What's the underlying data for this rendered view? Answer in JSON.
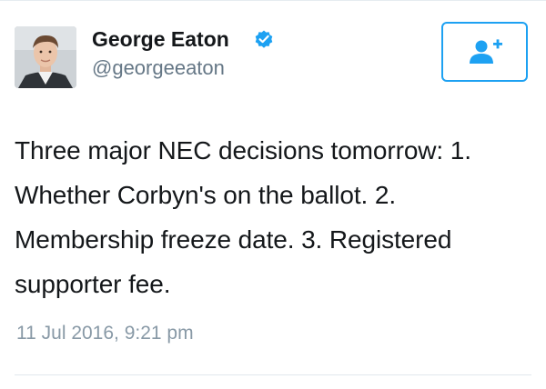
{
  "author": {
    "name": "George Eaton",
    "handle": "@georgeeaton",
    "verified": true
  },
  "tweet": {
    "text": "Three major NEC decisions tomorrow: 1. Whether Corbyn's on the ballot. 2. Membership freeze date. 3. Registered supporter fee.",
    "timestamp": "11 Jul 2016, 9:21 pm"
  },
  "icons": {
    "verified": "verified-badge-icon",
    "follow": "add-user-icon"
  },
  "colors": {
    "brand_blue": "#1da1f2",
    "name_text": "#14171a",
    "secondary_text": "#657786",
    "timestamp_text": "#8899a6",
    "divider": "#e1e8ed"
  }
}
